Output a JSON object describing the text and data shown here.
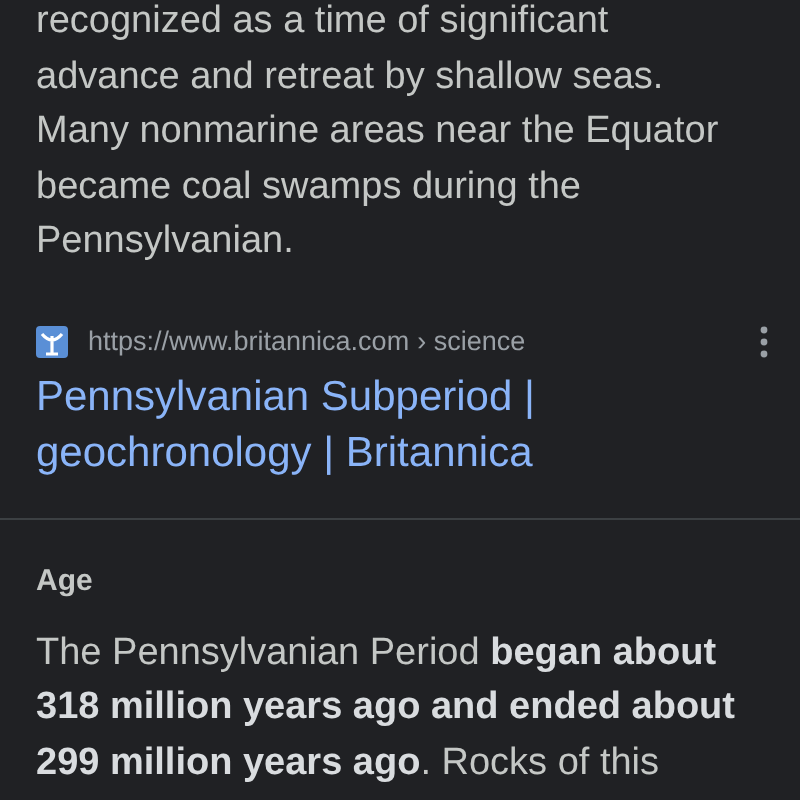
{
  "snippet": "recognized as a time of significant advance and retreat by shallow seas. Many nonmarine areas near the Equator became coal swamps during the Pennsylvanian.",
  "result": {
    "url": "https://www.britannica.com",
    "path": "› science",
    "title": "Pennsylvanian Subperiod | geochronology | Britannica"
  },
  "section": {
    "heading": "Age",
    "text": "The Pennsylvanian Period **began about 318 million years ago and ended about 299 million years ago**. Rocks of this"
  }
}
